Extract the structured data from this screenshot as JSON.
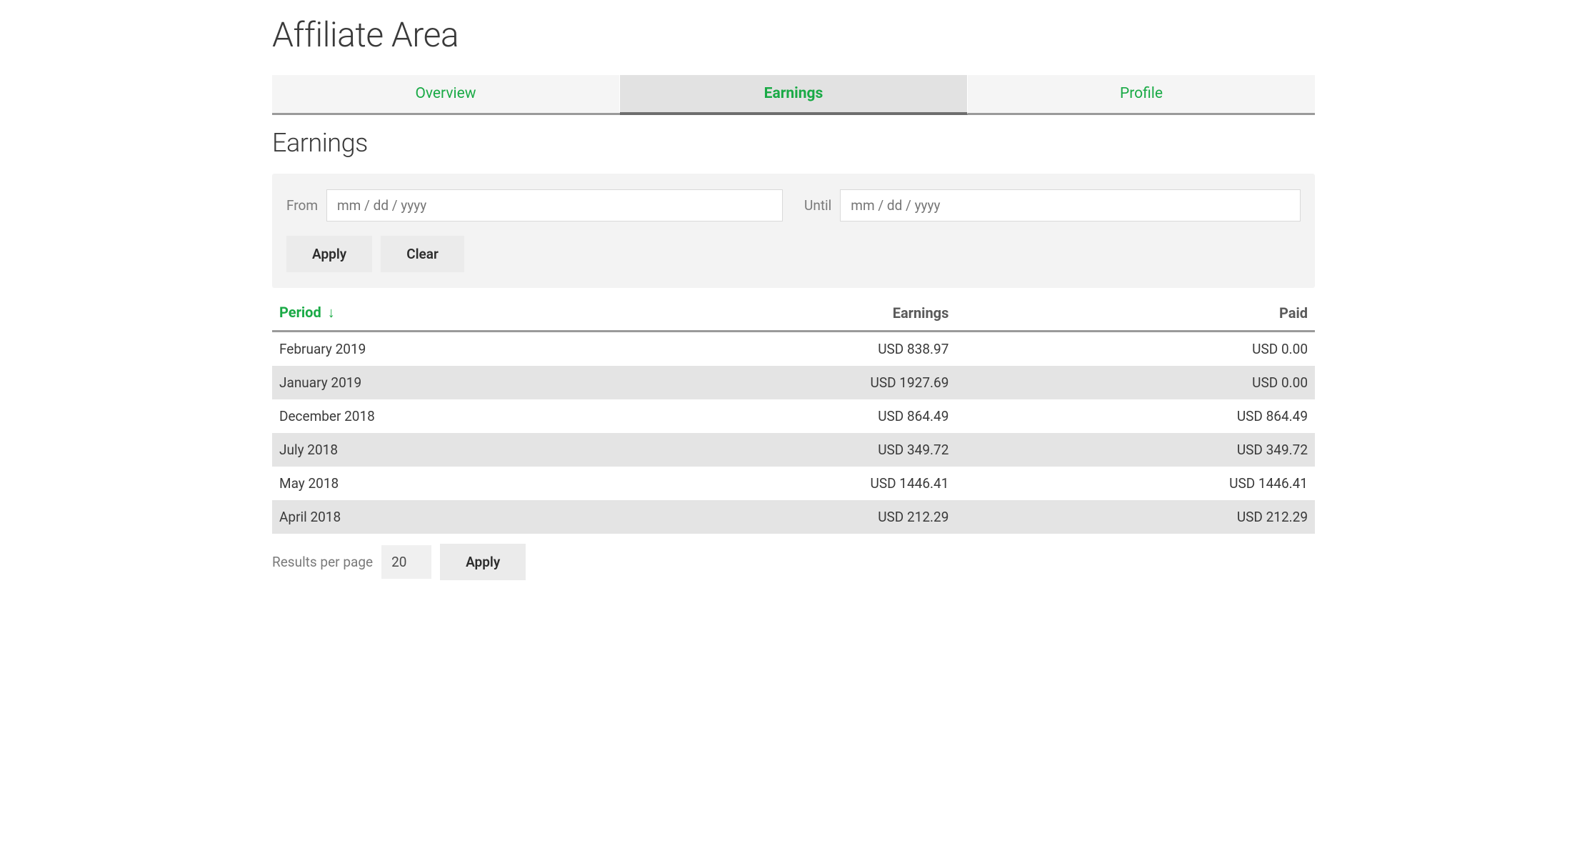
{
  "page_title": "Affiliate Area",
  "tabs": [
    {
      "label": "Overview",
      "active": false
    },
    {
      "label": "Earnings",
      "active": true
    },
    {
      "label": "Profile",
      "active": false
    }
  ],
  "section_title": "Earnings",
  "filter": {
    "from_label": "From",
    "from_placeholder": "mm / dd / yyyy",
    "until_label": "Until",
    "until_placeholder": "mm / dd / yyyy",
    "apply_label": "Apply",
    "clear_label": "Clear"
  },
  "table": {
    "headers": {
      "period": "Period",
      "sort_indicator": "↓",
      "earnings": "Earnings",
      "paid": "Paid"
    },
    "rows": [
      {
        "period": "February 2019",
        "earnings": "USD 838.97",
        "paid": "USD 0.00"
      },
      {
        "period": "January 2019",
        "earnings": "USD 1927.69",
        "paid": "USD 0.00"
      },
      {
        "period": "December 2018",
        "earnings": "USD 864.49",
        "paid": "USD 864.49"
      },
      {
        "period": "July 2018",
        "earnings": "USD 349.72",
        "paid": "USD 349.72"
      },
      {
        "period": "May 2018",
        "earnings": "USD 1446.41",
        "paid": "USD 1446.41"
      },
      {
        "period": "April 2018",
        "earnings": "USD 212.29",
        "paid": "USD 212.29"
      }
    ]
  },
  "pager": {
    "label": "Results per page",
    "value": "20",
    "apply_label": "Apply"
  }
}
